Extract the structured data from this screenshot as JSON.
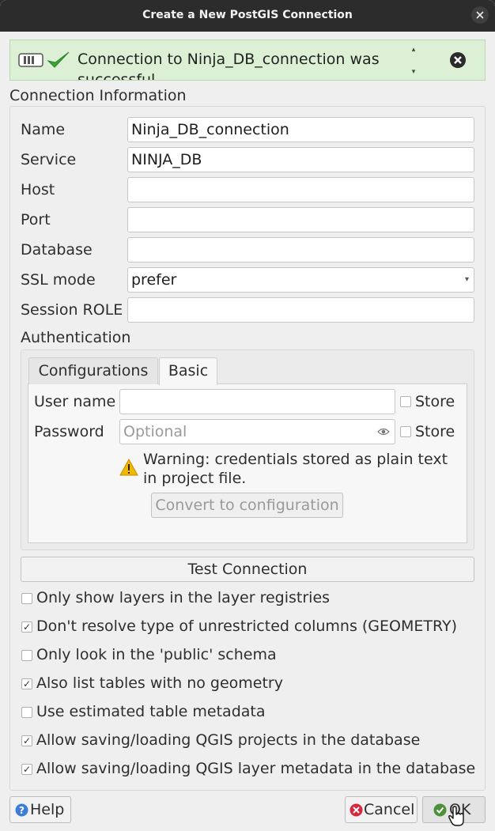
{
  "window": {
    "title": "Create a New PostGIS Connection"
  },
  "message": {
    "text": "Connection to Ninja_DB_connection was successful"
  },
  "connection": {
    "group_label": "Connection Information",
    "name_label": "Name",
    "name_value": "Ninja_DB_connection",
    "service_label": "Service",
    "service_value": "NINJA_DB",
    "host_label": "Host",
    "host_value": "",
    "port_label": "Port",
    "port_value": "",
    "database_label": "Database",
    "database_value": "",
    "ssl_label": "SSL mode",
    "ssl_value": "prefer",
    "role_label": "Session ROLE",
    "role_value": ""
  },
  "auth": {
    "label": "Authentication",
    "tabs": [
      "Configurations",
      "Basic"
    ],
    "active_tab": "Basic",
    "username_label": "User name",
    "username_value": "",
    "password_label": "Password",
    "password_placeholder": "Optional",
    "store_label": "Store",
    "warning": "Warning: credentials stored as plain text in project file.",
    "convert_button": "Convert to configuration"
  },
  "test_button": "Test Connection",
  "options": [
    {
      "label": "Only show layers in the layer registries",
      "checked": false
    },
    {
      "label": "Don't resolve type of unrestricted columns (GEOMETRY)",
      "checked": true
    },
    {
      "label": "Only look in the 'public' schema",
      "checked": false
    },
    {
      "label": "Also list tables with no geometry",
      "checked": true
    },
    {
      "label": "Use estimated table metadata",
      "checked": false
    },
    {
      "label": "Allow saving/loading QGIS projects in the database",
      "checked": true
    },
    {
      "label": "Allow saving/loading QGIS layer metadata in the database",
      "checked": true
    }
  ],
  "footer": {
    "help": "Help",
    "cancel": "Cancel",
    "ok": "OK"
  },
  "colors": {
    "titlebar": "#2c2c2c",
    "success_bg": "#dcf0d6",
    "check_green": "#3aa63a",
    "warning": "#f2b800",
    "cancel_red": "#d7263d"
  },
  "icons": [
    "close-icon",
    "message-stack-icon",
    "success-check-icon",
    "scroll-up-icon",
    "scroll-down-icon",
    "dismiss-icon",
    "chevron-down-icon",
    "eye-icon",
    "warning-icon",
    "help-icon",
    "cancel-icon",
    "ok-icon",
    "mouse-cursor-icon"
  ]
}
